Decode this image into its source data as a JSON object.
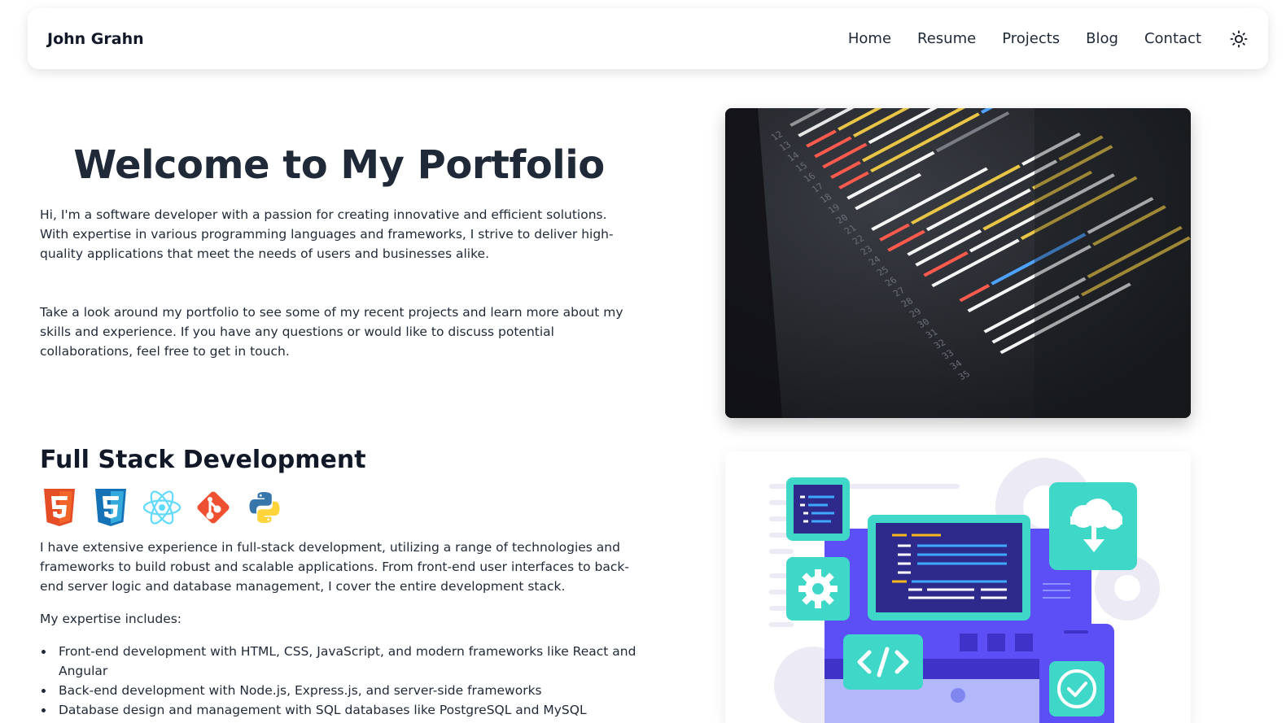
{
  "nav": {
    "brand": "John Grahn",
    "links": [
      "Home",
      "Resume",
      "Projects",
      "Blog",
      "Contact"
    ],
    "theme_icon": "sun-icon"
  },
  "hero": {
    "title": "Welcome to My Portfolio",
    "p1": "Hi, I'm a software developer with a passion for creating innovative and efficient solutions. With expertise in various programming languages and frameworks, I strive to deliver high-quality applications that meet the needs of users and businesses alike.",
    "p2": "Take a look around my portfolio to see some of my recent projects and learn more about my skills and experience. If you have any questions or would like to discuss potential collaborations, feel free to get in touch."
  },
  "fullstack": {
    "title": "Full Stack Development",
    "icons": [
      "html5-icon",
      "css3-icon",
      "react-icon",
      "git-icon",
      "python-icon"
    ],
    "p1": "I have extensive experience in full-stack development, utilizing a range of technologies and frameworks to build robust and scalable applications. From front-end user interfaces to back-end server logic and database management, I cover the entire development stack.",
    "p2": "My expertise includes:",
    "items": [
      "Front-end development with HTML, CSS, JavaScript, and modern frameworks like React and Angular",
      "Back-end development with Node.js, Express.js, and server-side frameworks",
      "Database design and management with SQL databases like PostgreSQL and MySQL"
    ]
  },
  "images": {
    "code_image": "code-screenshot-image",
    "dev_illustration": "development-illustration"
  },
  "colors": {
    "text": "#1f2937",
    "html5": "#e44d26",
    "css3": "#1572b6",
    "react": "#61dafb",
    "git": "#f05032",
    "python_blue": "#3776ab",
    "python_yellow": "#ffd43b",
    "illus_purple": "#5b4ff5",
    "illus_teal": "#3fd8c8"
  }
}
